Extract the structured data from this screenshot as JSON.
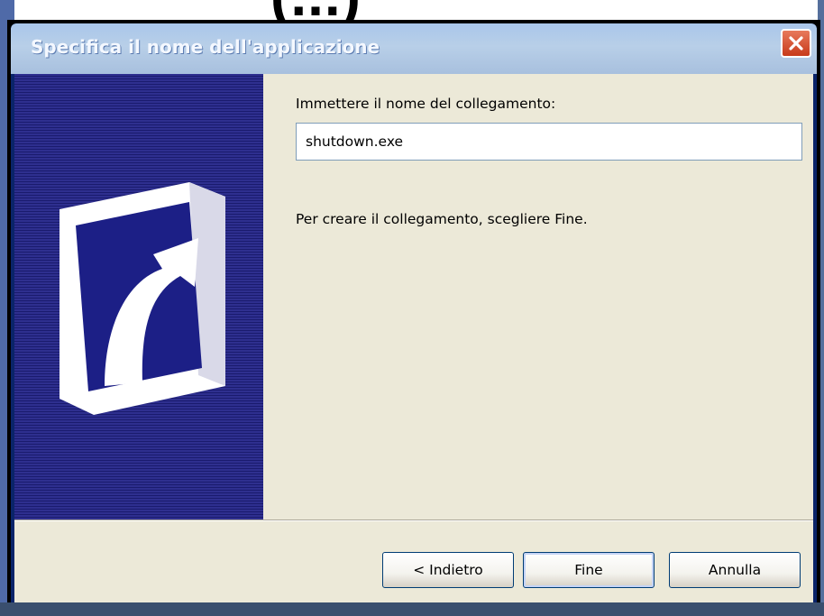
{
  "background": {
    "top_title_fragment": "(...)"
  },
  "window": {
    "title": "Specifica il nome dell'applicazione",
    "close_icon": "close-x-icon"
  },
  "side_panel": {
    "icon": "shortcut-arrow-icon",
    "colors": {
      "stripe_light": "#2e2f8f",
      "stripe_dark": "#1a1b6e"
    }
  },
  "form": {
    "prompt_label": "Immettere il nome del collegamento:",
    "name_value": "shutdown.exe",
    "info_text": "Per creare il collegamento, scegliere Fine."
  },
  "buttons": {
    "back": "< Indietro",
    "finish": "Fine",
    "cancel": "Annulla"
  },
  "colors": {
    "titlebar": "#a9c6ea",
    "client": "#ece9d8",
    "close_button": "#c73a1a"
  }
}
